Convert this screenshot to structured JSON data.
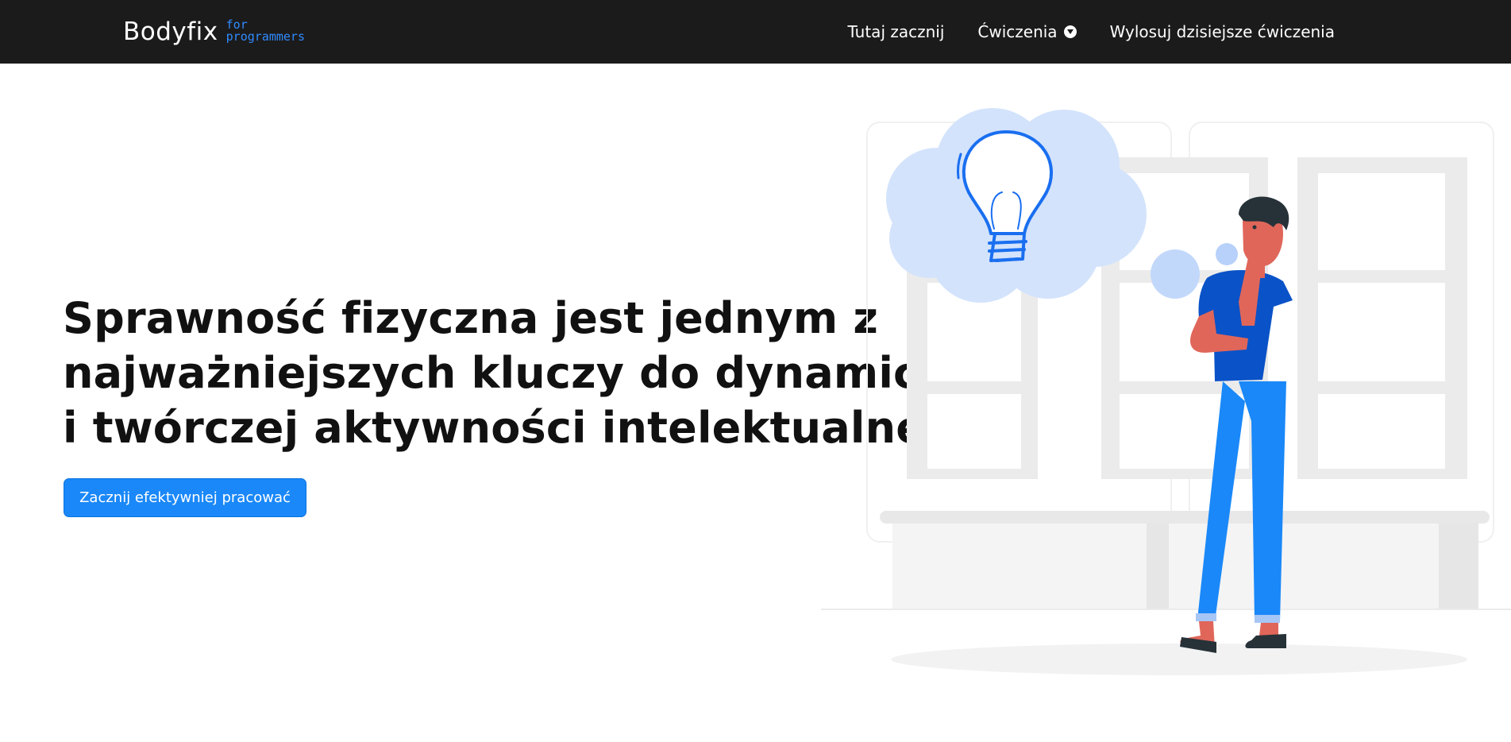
{
  "brand": {
    "name": "Bodyfix",
    "sub_line1": "for",
    "sub_line2": "programmers"
  },
  "nav": {
    "items": [
      {
        "label": "Tutaj zacznij"
      },
      {
        "label": "Ćwiczenia",
        "has_dropdown": true
      },
      {
        "label": "Wylosuj dzisiejsze ćwiczenia"
      }
    ]
  },
  "hero": {
    "title": "Sprawność fizyczna jest jednym z najważniejszych kluczy do dynamicznej i twórczej aktywności intelektualnej.",
    "cta_label": "Zacznij efektywniej pracować"
  },
  "colors": {
    "navbar_bg": "#1c1b1b",
    "accent": "#1a88f8",
    "brand_sub": "#2f8bff"
  }
}
